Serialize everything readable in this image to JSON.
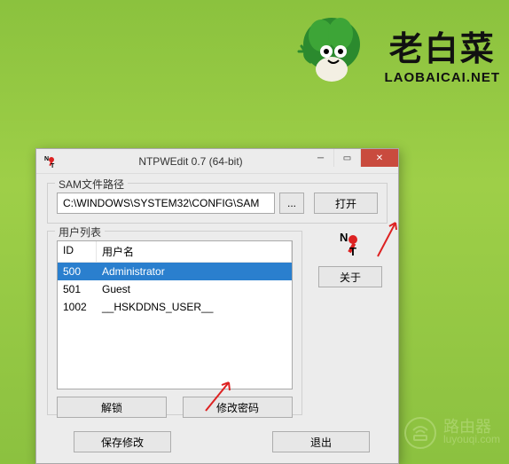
{
  "brand": {
    "title": "老白菜",
    "subtitle": "LAOBAICAI.NET"
  },
  "window": {
    "title": "NTPWEdit 0.7 (64-bit)",
    "path_group": {
      "legend": "SAM文件路径",
      "value": "C:\\WINDOWS\\SYSTEM32\\CONFIG\\SAM",
      "browse": "...",
      "open": "打开"
    },
    "users": {
      "legend": "用户列表",
      "col_id": "ID",
      "col_name": "用户名",
      "rows": [
        {
          "id": "500",
          "name": "Administrator",
          "selected": true
        },
        {
          "id": "501",
          "name": "Guest",
          "selected": false
        },
        {
          "id": "1002",
          "name": "__HSKDDNS_USER__",
          "selected": false
        }
      ],
      "unlock": "解锁",
      "changepw": "修改密码"
    },
    "about": "关于",
    "save": "保存修改",
    "exit": "退出"
  },
  "footer": {
    "label": "路由器",
    "site": "luyouqi.com"
  }
}
